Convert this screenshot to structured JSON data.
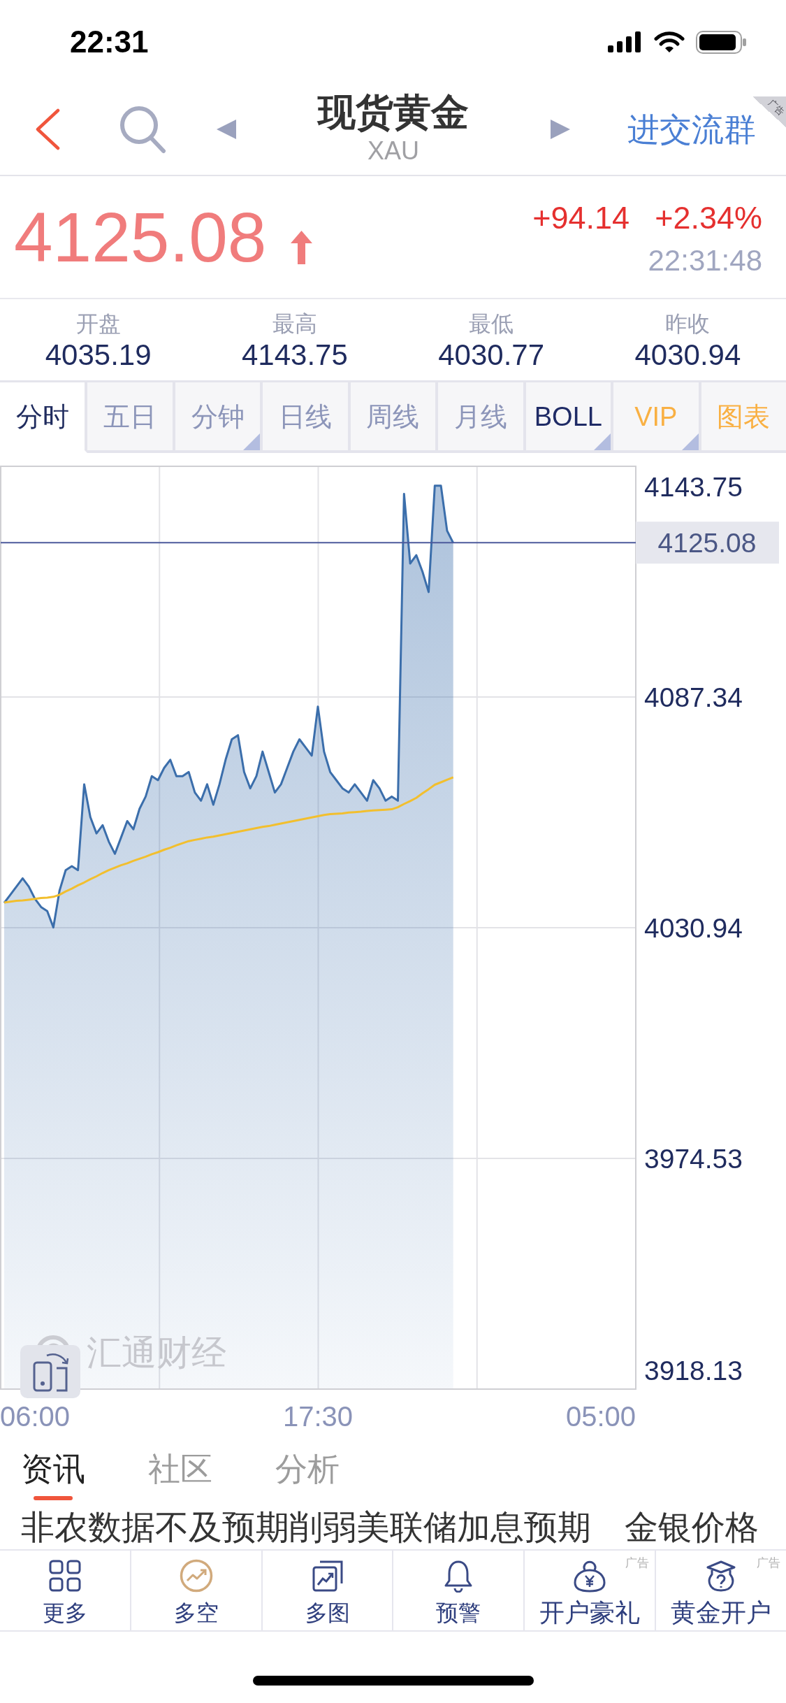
{
  "status_bar": {
    "time": "22:31"
  },
  "nav_bar": {
    "title": "现货黄金",
    "subtitle": "XAU",
    "group_link": "进交流群",
    "ad_tag": "广告"
  },
  "quote": {
    "price": "4125.08",
    "rising": true,
    "change": "+94.14",
    "change_percent": "+2.34%",
    "time": "22:31:48"
  },
  "stats": [
    {
      "label": "开盘",
      "value": "4035.19"
    },
    {
      "label": "最高",
      "value": "4143.75"
    },
    {
      "label": "最低",
      "value": "4030.77"
    },
    {
      "label": "昨收",
      "value": "4030.94"
    }
  ],
  "chart_tabs": [
    {
      "label": "分时",
      "kind": "period",
      "selected": true,
      "dropdown": false
    },
    {
      "label": "五日",
      "kind": "period",
      "selected": false,
      "dropdown": false
    },
    {
      "label": "分钟",
      "kind": "period",
      "selected": false,
      "dropdown": true
    },
    {
      "label": "日线",
      "kind": "period",
      "selected": false,
      "dropdown": false
    },
    {
      "label": "周线",
      "kind": "period",
      "selected": false,
      "dropdown": false
    },
    {
      "label": "月线",
      "kind": "period",
      "selected": false,
      "dropdown": false
    },
    {
      "label": "BOLL",
      "kind": "indicator",
      "selected": false,
      "dropdown": true
    },
    {
      "label": "VIP",
      "kind": "promo",
      "selected": false,
      "dropdown": true
    },
    {
      "label": "图表",
      "kind": "promo",
      "selected": false,
      "dropdown": false
    }
  ],
  "chart": {
    "logo": "汇通财经",
    "chart_data": {
      "type": "area",
      "grid": true,
      "categories": [
        null,
        null,
        null,
        null,
        null,
        "06:00",
        null,
        null,
        null,
        null,
        null,
        null,
        null,
        null,
        null,
        null,
        null,
        null,
        null,
        null,
        null,
        null,
        null,
        null,
        null,
        null,
        null,
        null,
        null,
        null,
        null,
        null,
        null,
        null,
        null,
        null,
        null,
        null,
        null,
        null,
        null,
        null,
        null,
        null,
        null,
        null,
        null,
        null,
        null,
        null,
        null,
        "17:30",
        null,
        null,
        null,
        null,
        null,
        null,
        null,
        null,
        null,
        null,
        null,
        null,
        null,
        null,
        null,
        null,
        null,
        null,
        null,
        null,
        null,
        null,
        null,
        null,
        null,
        null,
        null,
        null,
        null,
        null,
        null,
        null,
        null,
        null,
        null,
        null,
        null,
        null,
        null,
        null,
        null,
        null,
        null,
        null,
        null,
        "05:00"
      ],
      "ylim": [
        3918.13,
        4143.75
      ],
      "yticks": [
        3918.13,
        3974.53,
        4030.94,
        4087.34,
        4143.75
      ],
      "series": [
        {
          "color": "#3b6eab",
          "values": [
            4037,
            4039,
            4041,
            4043,
            4041,
            4038,
            4036,
            4035,
            4031,
            4040,
            4045,
            4046,
            4045,
            4066,
            4058,
            4054,
            4056,
            4052,
            4049,
            4053,
            4057,
            4055,
            4060,
            4063,
            4068,
            4067,
            4070,
            4072,
            4068,
            4068,
            4069,
            4064,
            4062,
            4066,
            4061,
            4066,
            4072,
            4077,
            4078,
            4069,
            4065,
            4068,
            4074,
            4069,
            4064,
            4066,
            4070,
            4074,
            4077,
            4075,
            4073,
            4085,
            4074,
            4069,
            4067,
            4065,
            4064,
            4066,
            4064,
            4062,
            4067,
            4065,
            4062,
            4063,
            4062,
            4137,
            4120,
            4122,
            4118,
            4113,
            4139,
            4139,
            4128,
            4125,
            null,
            null,
            null,
            null,
            null,
            null,
            null,
            null,
            null,
            null,
            null,
            null,
            null,
            null,
            null,
            null,
            null,
            null,
            null,
            null,
            null,
            null,
            null,
            null
          ]
        },
        {
          "type": "line",
          "color": "#f2bf2e",
          "values": [
            4037.1,
            4037.3,
            4037.5,
            4037.6,
            4037.8,
            4038.0,
            4038.2,
            4038.3,
            4038.5,
            4039.0,
            4039.8,
            4040.5,
            4041.3,
            4042.0,
            4042.8,
            4043.5,
            4044.3,
            4045.0,
            4045.6,
            4046.2,
            4046.7,
            4047.3,
            4047.8,
            4048.3,
            4048.9,
            4049.4,
            4050.0,
            4050.5,
            4051.1,
            4051.6,
            4052.1,
            4052.4,
            4052.7,
            4053.0,
            4053.2,
            4053.5,
            4053.8,
            4054.1,
            4054.4,
            4054.7,
            4055.0,
            4055.3,
            4055.6,
            4055.8,
            4056.1,
            4056.4,
            4056.7,
            4057.0,
            4057.3,
            4057.6,
            4057.9,
            4058.2,
            4058.5,
            4058.7,
            4058.8,
            4058.9,
            4059.1,
            4059.2,
            4059.3,
            4059.5,
            4059.6,
            4059.7,
            4059.8,
            4059.9,
            4060.4,
            4061.2,
            4061.9,
            4062.7,
            4063.8,
            4064.8,
            4065.9,
            4066.5,
            4067.1,
            4067.7,
            null,
            null,
            null,
            null,
            null,
            null,
            null,
            null,
            null,
            null,
            null,
            null,
            null,
            null,
            null,
            null,
            null,
            null,
            null,
            null,
            null,
            null,
            null,
            null
          ]
        }
      ],
      "ref_lines": [
        {
          "axis": "y",
          "value": 4125.08,
          "label": "4125.08"
        }
      ]
    }
  },
  "news_tabs": [
    {
      "label": "资讯",
      "selected": true
    },
    {
      "label": "社区",
      "selected": false
    },
    {
      "label": "分析",
      "selected": false
    }
  ],
  "headline": "非农数据不及预期削弱美联储加息预期　金银价格",
  "bottom_nav": [
    {
      "label": "更多"
    },
    {
      "label": "多空"
    },
    {
      "label": "多图"
    },
    {
      "label": "预警"
    },
    {
      "label": "开户豪礼",
      "ad_tag": "广告"
    },
    {
      "label": "黄金开户",
      "ad_tag": "广告"
    }
  ]
}
